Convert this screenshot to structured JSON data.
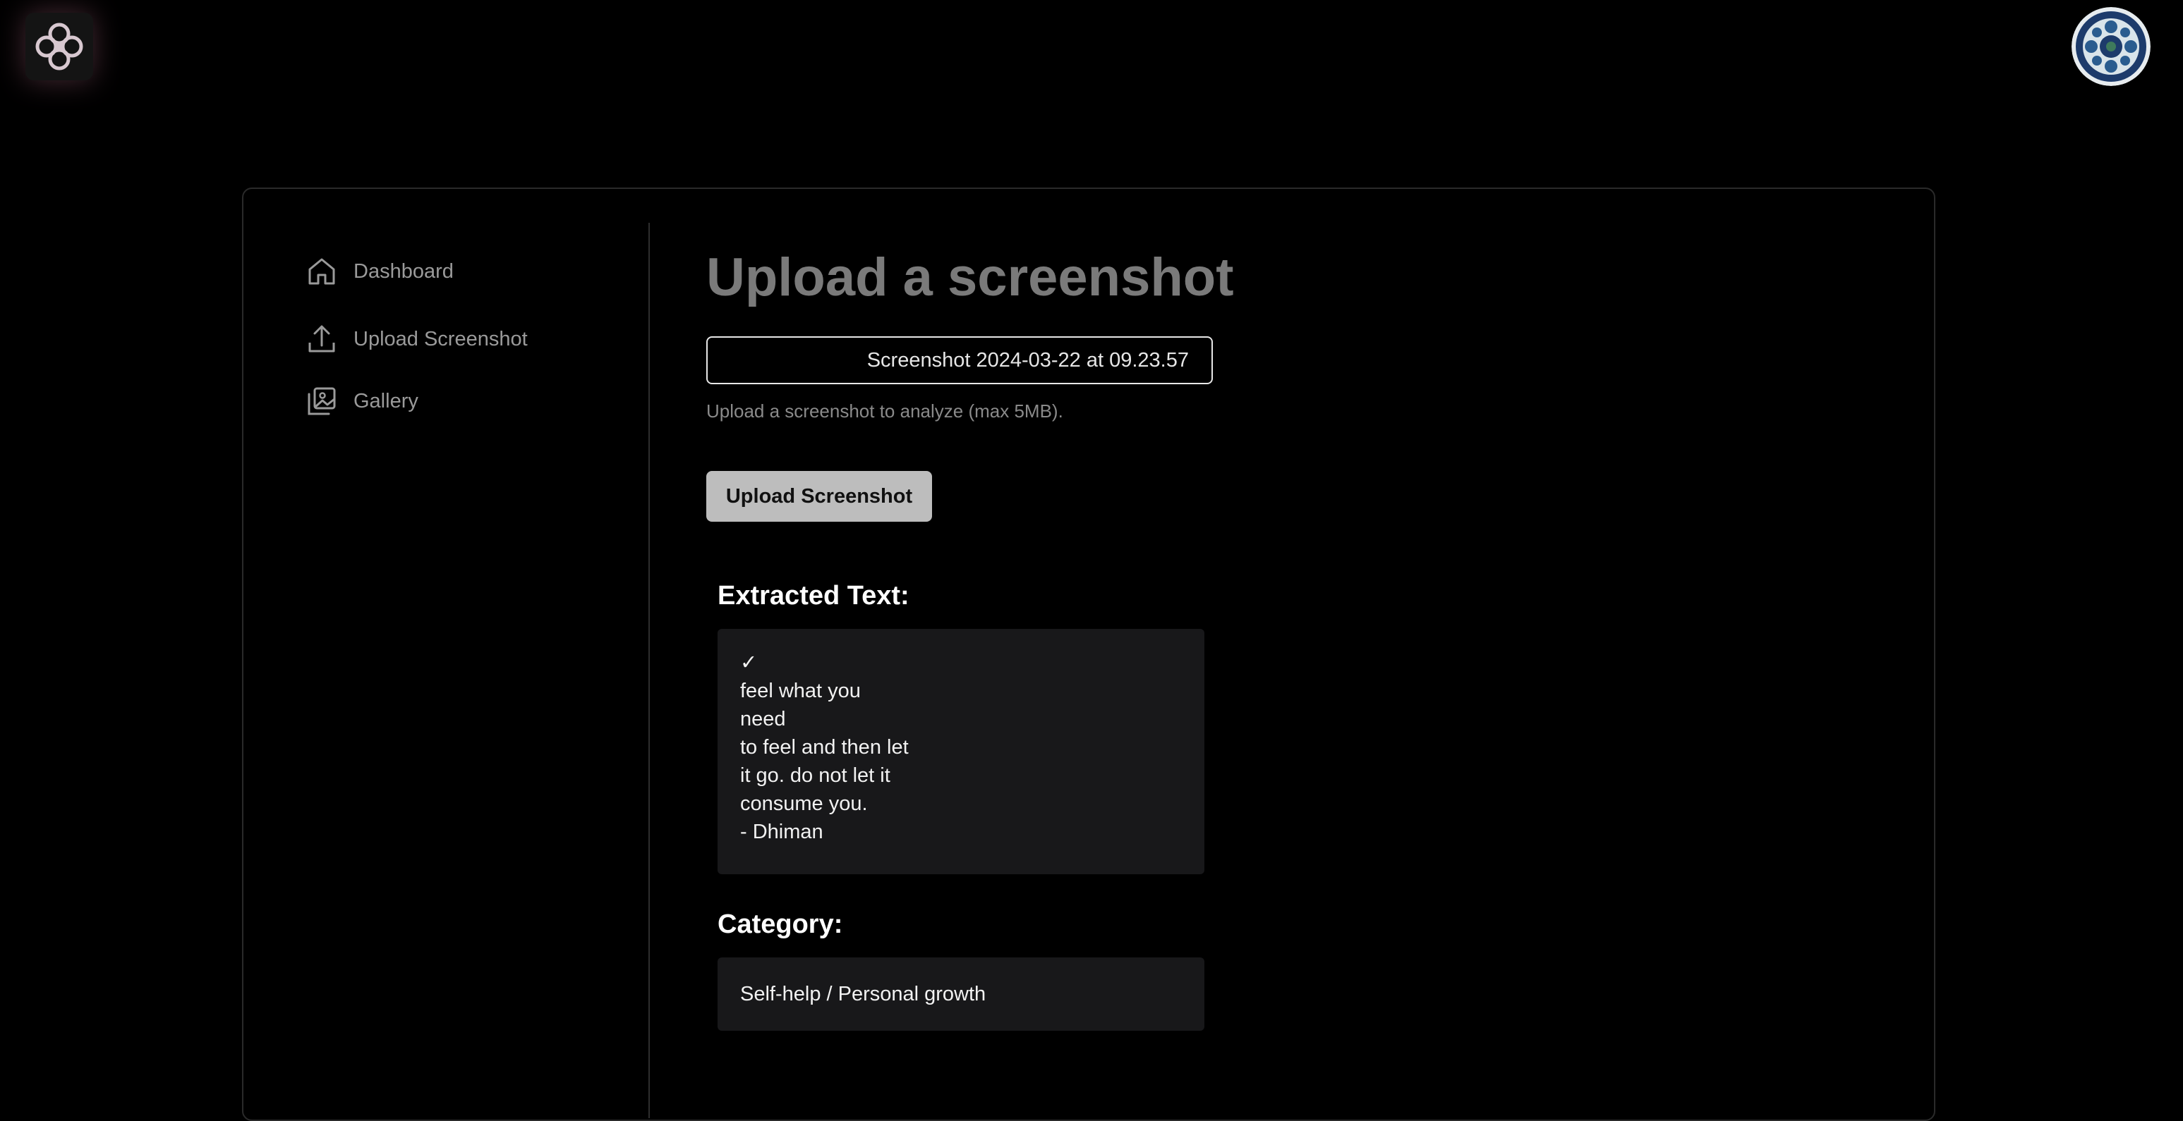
{
  "header": {
    "logo_icon": "flower-logo-icon",
    "avatar_icon": "mosaic-avatar"
  },
  "sidebar": {
    "items": [
      {
        "label": "Dashboard",
        "icon": "home-icon"
      },
      {
        "label": "Upload Screenshot",
        "icon": "upload-icon"
      },
      {
        "label": "Gallery",
        "icon": "gallery-icon"
      }
    ]
  },
  "main": {
    "title": "Upload a screenshot",
    "file_input": {
      "value": "Screenshot 2024-03-22 at 09.23.57"
    },
    "hint": "Upload a screenshot to analyze (max 5MB).",
    "upload_button_label": "Upload Screenshot",
    "extracted": {
      "heading": "Extracted Text:",
      "lines": [
        "✓",
        "feel what you",
        "need",
        "to feel and then let",
        "it go. do not let it",
        "consume you.",
        "- Dhiman"
      ]
    },
    "category": {
      "heading": "Category:",
      "value": "Self-help / Personal growth"
    }
  },
  "colors": {
    "background": "#000000",
    "muted_text": "#9a9a9a",
    "title_text": "#7a7a7a",
    "button_bg": "#bdbdbd",
    "panel_bg": "#18181a"
  }
}
